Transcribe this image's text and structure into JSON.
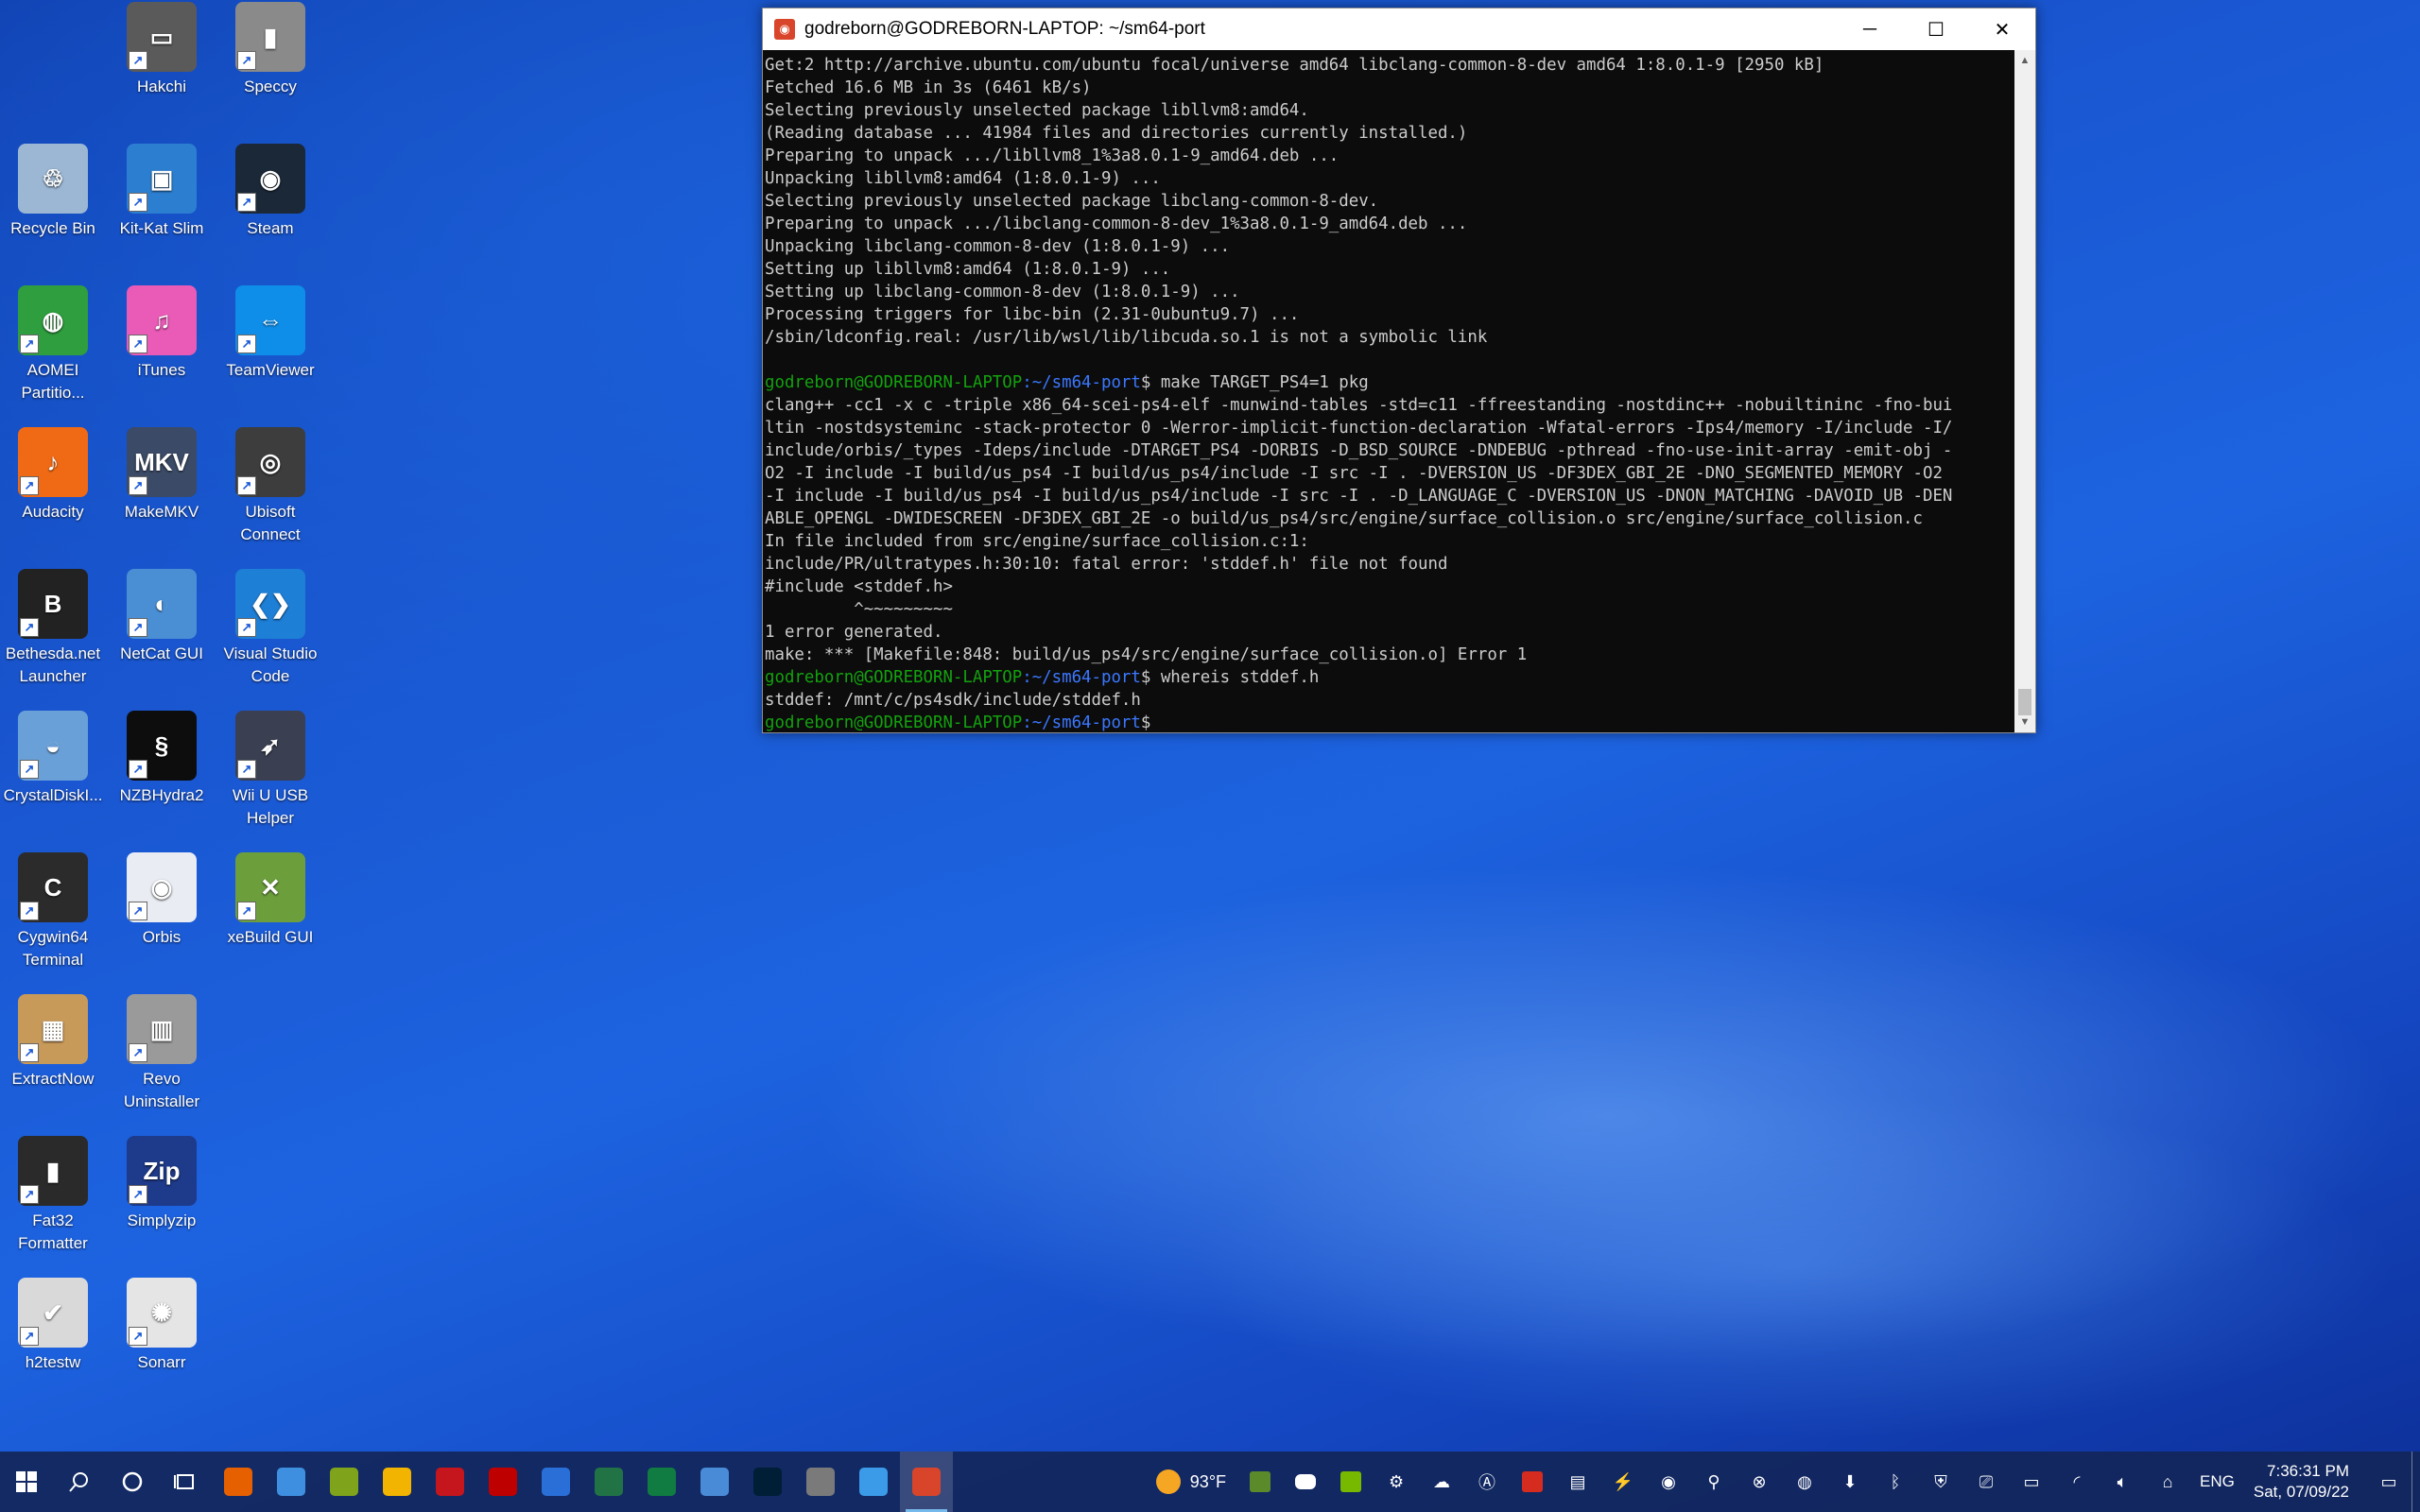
{
  "desktop": {
    "icons": [
      {
        "label": "Hakchi",
        "color": "#5a5a5a",
        "glyph": "▭"
      },
      {
        "label": "Speccy",
        "color": "#8a8a8a",
        "glyph": "▮"
      },
      {
        "label": "Recycle Bin",
        "color": "#9bb7d4",
        "glyph": "♲"
      },
      {
        "label": "Kit-Kat Slim",
        "color": "#2c7fd0",
        "glyph": "▣"
      },
      {
        "label": "Steam",
        "color": "#1b2838",
        "glyph": "◉"
      },
      {
        "label": "AOMEI Partitio...",
        "color": "#2e9e3e",
        "glyph": "◍"
      },
      {
        "label": "iTunes",
        "color": "#e95bb6",
        "glyph": "♫"
      },
      {
        "label": "TeamViewer",
        "color": "#0e8ee9",
        "glyph": "⇔"
      },
      {
        "label": "Audacity",
        "color": "#f06a15",
        "glyph": "♪"
      },
      {
        "label": "MakeMKV",
        "color": "#3b4a66",
        "glyph": "MKV"
      },
      {
        "label": "Ubisoft Connect",
        "color": "#3d3d3d",
        "glyph": "◎"
      },
      {
        "label": "Bethesda.net Launcher",
        "color": "#222222",
        "glyph": "B"
      },
      {
        "label": "NetCat GUI",
        "color": "#4a8fd4",
        "glyph": "◐"
      },
      {
        "label": "Visual Studio Code",
        "color": "#1e7fd6",
        "glyph": "❮❯"
      },
      {
        "label": "CrystalDiskI...",
        "color": "#6aa0d8",
        "glyph": "◒"
      },
      {
        "label": "NZBHydra2",
        "color": "#0d0d0d",
        "glyph": "§"
      },
      {
        "label": "Wii U USB Helper",
        "color": "#3a3f52",
        "glyph": "➶"
      },
      {
        "label": "Cygwin64 Terminal",
        "color": "#2b2b2b",
        "glyph": "C"
      },
      {
        "label": "Orbis",
        "color": "#e9ecf2",
        "glyph": "◉"
      },
      {
        "label": "xeBuild GUI",
        "color": "#6c9f3c",
        "glyph": "✕"
      },
      {
        "label": "ExtractNow",
        "color": "#c89a5a",
        "glyph": "▦"
      },
      {
        "label": "Revo Uninstaller",
        "color": "#9a9a9a",
        "glyph": "▥"
      },
      {
        "label": "Fat32 Formatter",
        "color": "#2a2a2a",
        "glyph": "▮"
      },
      {
        "label": "Simplyzip",
        "color": "#1e3a8a",
        "glyph": "Zip"
      },
      {
        "label": "h2testw",
        "color": "#d9d9d9",
        "glyph": "✔"
      },
      {
        "label": "Sonarr",
        "color": "#e5e5e5",
        "glyph": "✺"
      }
    ]
  },
  "window": {
    "title": "godreborn@GODREBORN-LAPTOP: ~/sm64-port",
    "icon": "ubuntu-terminal-icon",
    "lines": [
      {
        "t": "Get:2 http://archive.ubuntu.com/ubuntu focal/universe amd64 libclang-common-8-dev amd64 1:8.0.1-9 [2950 kB]"
      },
      {
        "t": "Fetched 16.6 MB in 3s (6461 kB/s)"
      },
      {
        "t": "Selecting previously unselected package libllvm8:amd64."
      },
      {
        "t": "(Reading database ... 41984 files and directories currently installed.)"
      },
      {
        "t": "Preparing to unpack .../libllvm8_1%3a8.0.1-9_amd64.deb ..."
      },
      {
        "t": "Unpacking libllvm8:amd64 (1:8.0.1-9) ..."
      },
      {
        "t": "Selecting previously unselected package libclang-common-8-dev."
      },
      {
        "t": "Preparing to unpack .../libclang-common-8-dev_1%3a8.0.1-9_amd64.deb ..."
      },
      {
        "t": "Unpacking libclang-common-8-dev (1:8.0.1-9) ..."
      },
      {
        "t": "Setting up libllvm8:amd64 (1:8.0.1-9) ..."
      },
      {
        "t": "Setting up libclang-common-8-dev (1:8.0.1-9) ..."
      },
      {
        "t": "Processing triggers for libc-bin (2.31-0ubuntu9.7) ..."
      },
      {
        "t": "/sbin/ldconfig.real: /usr/lib/wsl/lib/libcuda.so.1 is not a symbolic link"
      },
      {
        "t": ""
      },
      {
        "user": "godreborn@GODREBORN-LAPTOP",
        "path": ":~/sm64-port",
        "cmd": "$ make TARGET_PS4=1 pkg"
      },
      {
        "t": "clang++ -cc1 -x c -triple x86_64-scei-ps4-elf -munwind-tables -std=c11 -ffreestanding -nostdinc++ -nobuiltininc -fno-bui"
      },
      {
        "t": "ltin -nostdsysteminc -stack-protector 0 -Werror-implicit-function-declaration -Wfatal-errors -Ips4/memory -I/include -I/"
      },
      {
        "t": "include/orbis/_types -Ideps/include -DTARGET_PS4 -DORBIS -D_BSD_SOURCE -DNDEBUG -pthread -fno-use-init-array -emit-obj -"
      },
      {
        "t": "O2 -I include -I build/us_ps4 -I build/us_ps4/include -I src -I . -DVERSION_US -DF3DEX_GBI_2E -DNO_SEGMENTED_MEMORY -O2"
      },
      {
        "t": "-I include -I build/us_ps4 -I build/us_ps4/include -I src -I . -D_LANGUAGE_C -DVERSION_US -DNON_MATCHING -DAVOID_UB -DEN"
      },
      {
        "t": "ABLE_OPENGL -DWIDESCREEN -DF3DEX_GBI_2E -o build/us_ps4/src/engine/surface_collision.o src/engine/surface_collision.c"
      },
      {
        "t": "In file included from src/engine/surface_collision.c:1:"
      },
      {
        "t": "include/PR/ultratypes.h:30:10: fatal error: 'stddef.h' file not found"
      },
      {
        "t": "#include <stddef.h>"
      },
      {
        "t": "         ^~~~~~~~~~"
      },
      {
        "t": "1 error generated."
      },
      {
        "t": "make: *** [Makefile:848: build/us_ps4/src/engine/surface_collision.o] Error 1"
      },
      {
        "user": "godreborn@GODREBORN-LAPTOP",
        "path": ":~/sm64-port",
        "cmd": "$ whereis stddef.h"
      },
      {
        "t": "stddef: /mnt/c/ps4sdk/include/stddef.h"
      },
      {
        "user": "godreborn@GODREBORN-LAPTOP",
        "path": ":~/sm64-port",
        "cmd": "$ "
      }
    ]
  },
  "taskbar": {
    "apps": [
      {
        "name": "firefox",
        "color": "#e66000"
      },
      {
        "name": "explorer",
        "color": "#3f8fe0"
      },
      {
        "name": "app-green-gear",
        "color": "#7fa31a"
      },
      {
        "name": "chrome",
        "color": "#f2b400"
      },
      {
        "name": "app-red-qt",
        "color": "#c4161c"
      },
      {
        "name": "filezilla",
        "color": "#bf0000"
      },
      {
        "name": "app-blue-window",
        "color": "#2a6fd8"
      },
      {
        "name": "excel",
        "color": "#217346"
      },
      {
        "name": "app-green-sheet",
        "color": "#107c41"
      },
      {
        "name": "app-monitor",
        "color": "#4a8bd8"
      },
      {
        "name": "photoshop",
        "color": "#001e36"
      },
      {
        "name": "calculator",
        "color": "#7a7a7a"
      },
      {
        "name": "app-blue-arrow",
        "color": "#3b9be8"
      },
      {
        "name": "ubuntu-terminal",
        "color": "#d9452b",
        "active": true
      }
    ],
    "weather": "93°F",
    "language": "ENG",
    "time": "7:36:31 PM",
    "date": "Sat, 07/09/22"
  },
  "colors": {
    "prompt_user": "#13a10e",
    "prompt_path": "#3b78ff",
    "text": "#cccccc"
  }
}
